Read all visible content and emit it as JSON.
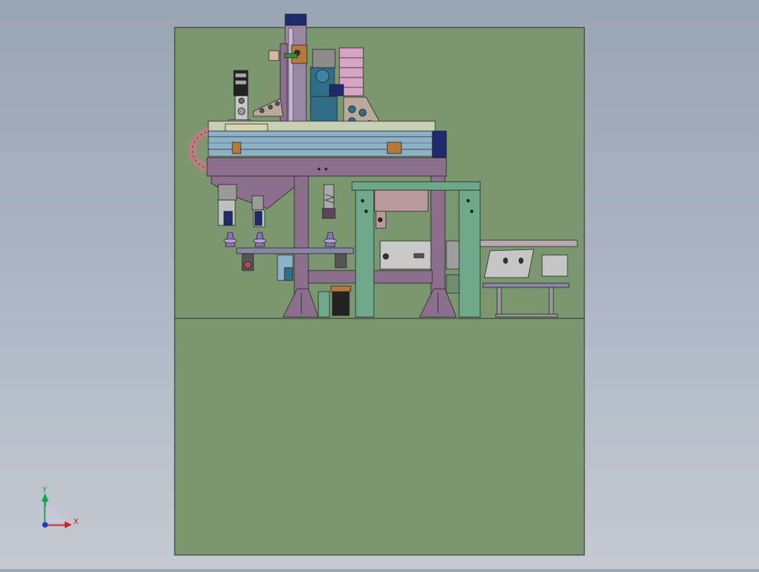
{
  "viewport": {
    "background_top": "#9aa5b3",
    "background_bottom": "#c4cad3",
    "panel_color": "#7a9770"
  },
  "colors": {
    "frame_purple": "#8c6f8c",
    "frame_purple_dark": "#5d455d",
    "frame_green": "#6fa888",
    "rail_blue": "#8fb1c8",
    "motor_blue": "#2f6e86",
    "motor_navy": "#1d2a6b",
    "cam_pink": "#d8a4c6",
    "cable_chain": "#b58080",
    "axis_x": "#d0202a",
    "axis_y": "#19a34a",
    "axis_z": "#1f3fb8"
  },
  "triad": {
    "x_label": "X",
    "y_label": "Y"
  }
}
